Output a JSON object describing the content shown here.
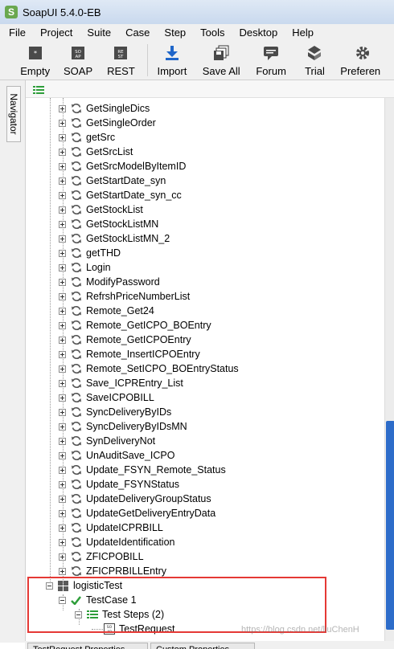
{
  "app": {
    "title": "SoapUI 5.4.0-EB",
    "logo_letter": "S"
  },
  "menu": [
    "File",
    "Project",
    "Suite",
    "Case",
    "Step",
    "Tools",
    "Desktop",
    "Help"
  ],
  "toolbar": [
    {
      "label": "Empty",
      "icon": "empty-project-icon"
    },
    {
      "label": "SOAP",
      "icon": "soap-project-icon"
    },
    {
      "label": "REST",
      "icon": "rest-project-icon"
    },
    {
      "label": "Import",
      "icon": "import-icon"
    },
    {
      "label": "Save All",
      "icon": "save-all-icon"
    },
    {
      "label": "Forum",
      "icon": "forum-icon"
    },
    {
      "label": "Trial",
      "icon": "trial-icon"
    },
    {
      "label": "Preferen",
      "icon": "preferences-gear-icon"
    }
  ],
  "navigator": {
    "tab_label": "Navigator"
  },
  "tree": {
    "operations": [
      "GetSingleDics",
      "GetSingleOrder",
      "getSrc",
      "GetSrcList",
      "GetSrcModelByItemID",
      "GetStartDate_syn",
      "GetStartDate_syn_cc",
      "GetStockList",
      "GetStockListMN",
      "GetStockListMN_2",
      "getTHD",
      "Login",
      "ModifyPassword",
      "RefrshPriceNumberList",
      "Remote_Get24",
      "Remote_GetICPO_BOEntry",
      "Remote_GetICPOEntry",
      "Remote_InsertICPOEntry",
      "Remote_SetICPO_BOEntryStatus",
      "Save_ICPREntry_List",
      "SaveICPOBILL",
      "SyncDeliveryByIDs",
      "SyncDeliveryByIDsMN",
      "SynDeliveryNot",
      "UnAuditSave_ICPO",
      "Update_FSYN_Remote_Status",
      "Update_FSYNStatus",
      "UpdateDeliveryGroupStatus",
      "UpdateGetDeliveryEntryData",
      "UpdateICPRBILL",
      "UpdateIdentification",
      "ZFICPOBILL",
      "ZFICPRBILLEntry"
    ],
    "test_suite": "logisticTest",
    "test_case": "TestCase 1",
    "test_steps": "Test Steps (2)",
    "test_request": "TestRequest"
  },
  "watermark": "https://blog.csdn.net/liuChenH",
  "bottom_tabs": [
    "TestRequest Properties",
    "Custom Properties"
  ],
  "colors": {
    "highlight": "#e53935",
    "scroll_thumb": "#2d6cc9",
    "check": "#2e9e3a"
  }
}
